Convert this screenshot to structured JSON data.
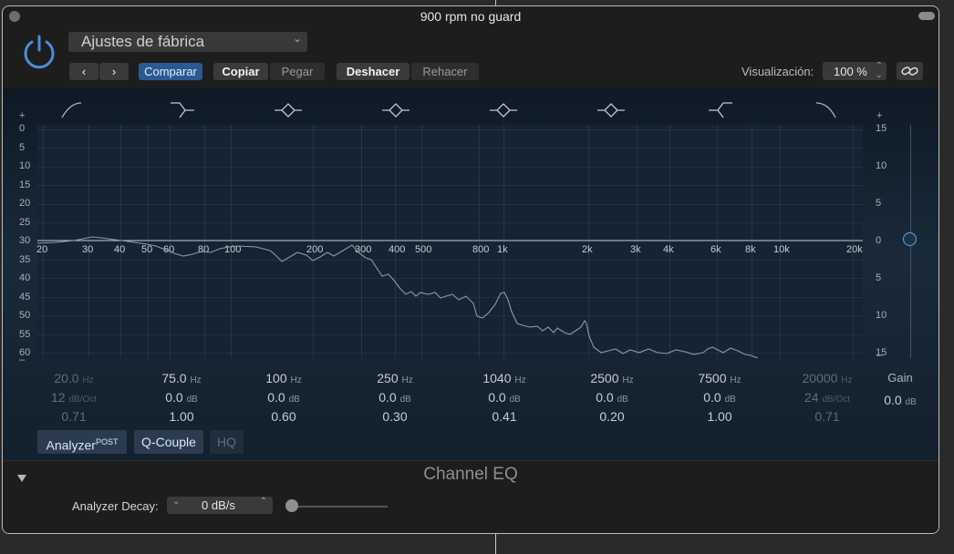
{
  "window": {
    "title": "900 rpm no guard"
  },
  "toolbar": {
    "preset": "Ajustes de fábrica",
    "back": "‹",
    "forward": "›",
    "compare": "Comparar",
    "copy": "Copiar",
    "paste": "Pegar",
    "undo": "Deshacer",
    "redo": "Rehacer",
    "view_label": "Visualización:",
    "view_value": "100 %"
  },
  "graph": {
    "left_plus": "+",
    "right_plus": "+",
    "left_minus": "–",
    "right_minus": "–",
    "left_scale": [
      "0",
      "5",
      "10",
      "15",
      "20",
      "25",
      "30",
      "35",
      "40",
      "45",
      "50",
      "55",
      "60"
    ],
    "right_scale": [
      "15",
      "10",
      "5",
      "0",
      "5",
      "10",
      "15"
    ],
    "freq_labels": [
      "20",
      "30",
      "40",
      "50",
      "60",
      "80",
      "100",
      "200",
      "300",
      "400",
      "500",
      "800",
      "1k",
      "2k",
      "3k",
      "4k",
      "6k",
      "8k",
      "10k",
      "20k"
    ]
  },
  "bands": [
    {
      "freq": "20.0",
      "funit": "Hz",
      "gain": "12",
      "gunit": "dB/Oct",
      "q": "0.71",
      "dim": true
    },
    {
      "freq": "75.0",
      "funit": "Hz",
      "gain": "0.0",
      "gunit": "dB",
      "q": "1.00",
      "dim": false
    },
    {
      "freq": "100",
      "funit": "Hz",
      "gain": "0.0",
      "gunit": "dB",
      "q": "0.60",
      "dim": false
    },
    {
      "freq": "250",
      "funit": "Hz",
      "gain": "0.0",
      "gunit": "dB",
      "q": "0.30",
      "dim": false
    },
    {
      "freq": "1040",
      "funit": "Hz",
      "gain": "0.0",
      "gunit": "dB",
      "q": "0.41",
      "dim": false
    },
    {
      "freq": "2500",
      "funit": "Hz",
      "gain": "0.0",
      "gunit": "dB",
      "q": "0.20",
      "dim": false
    },
    {
      "freq": "7500",
      "funit": "Hz",
      "gain": "0.0",
      "gunit": "dB",
      "q": "1.00",
      "dim": false
    },
    {
      "freq": "20000",
      "funit": "Hz",
      "gain": "24",
      "gunit": "dB/Oct",
      "q": "0.71",
      "dim": true
    }
  ],
  "gain": {
    "label": "Gain",
    "value": "0.0",
    "unit": "dB"
  },
  "buttons": {
    "analyzer": "Analyzer",
    "analyzer_sup": "POST",
    "qcouple": "Q-Couple",
    "hq": "HQ"
  },
  "footer": {
    "title": "Channel EQ",
    "decay_label": "Analyzer Decay:",
    "decay_value": "0 dB/s"
  }
}
